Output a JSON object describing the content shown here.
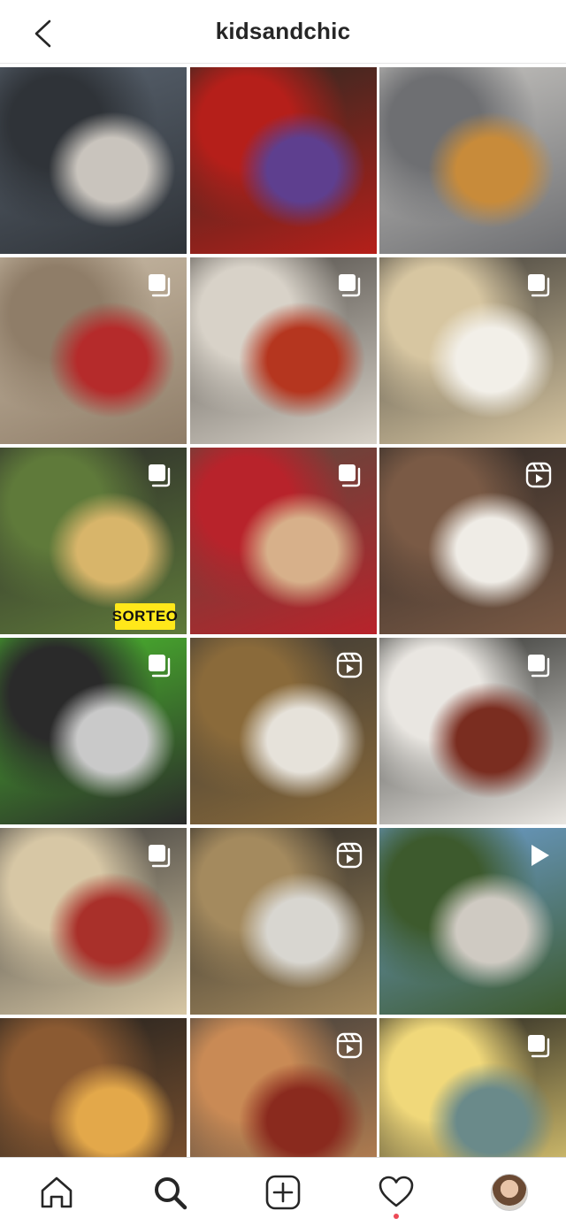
{
  "header": {
    "title": "kidsandchic",
    "back_icon": "chevron-left-icon"
  },
  "grid": {
    "tiles": [
      {
        "name": "beer-bottle-post",
        "badge": "none",
        "colors": [
          "#5a6470",
          "#2f3338",
          "#c9c4bd"
        ]
      },
      {
        "name": "strawberries-post",
        "badge": "none",
        "colors": [
          "#2a2a22",
          "#b51f1a",
          "#5e3f8f"
        ]
      },
      {
        "name": "french-toast-post",
        "badge": "none",
        "colors": [
          "#c8c6c2",
          "#6e6f72",
          "#c88b3a"
        ]
      },
      {
        "name": "woman-cathedral-post",
        "badge": "carousel",
        "colors": [
          "#c9bba6",
          "#8f7d68",
          "#b52b2b"
        ]
      },
      {
        "name": "soup-bowl-post",
        "badge": "carousel",
        "colors": [
          "#4e4a45",
          "#d8d2c8",
          "#b5361f"
        ]
      },
      {
        "name": "sugar-donuts-post",
        "badge": "carousel",
        "colors": [
          "#3f3c37",
          "#d7c6a1",
          "#f2efe8"
        ]
      },
      {
        "name": "gyoza-post",
        "badge": "carousel",
        "colors": [
          "#2b2b2a",
          "#5f7a3a",
          "#d8b56a"
        ]
      },
      {
        "name": "apple-pan-post",
        "badge": "carousel",
        "colors": [
          "#5b4a3e",
          "#b8232b",
          "#d7b08a"
        ]
      },
      {
        "name": "chocolate-dessert-post",
        "badge": "reel",
        "colors": [
          "#2c2725",
          "#7a5a45",
          "#efece6"
        ]
      },
      {
        "name": "sorteo-locker-post",
        "badge": "carousel",
        "colors": [
          "#4dbf2e",
          "#2a2a2a",
          "#c9c9c9"
        ]
      },
      {
        "name": "cream-soup-post",
        "badge": "reel",
        "colors": [
          "#3a3835",
          "#8a6a3a",
          "#e6e2da"
        ]
      },
      {
        "name": "glazed-donuts-post",
        "badge": "carousel",
        "colors": [
          "#2c2d2a",
          "#e9e6e1",
          "#7a2d20"
        ]
      },
      {
        "name": "bread-jam-post",
        "badge": "carousel",
        "colors": [
          "#3b3a38",
          "#d7c7a5",
          "#a9302a"
        ]
      },
      {
        "name": "cake-slice-post",
        "badge": "reel",
        "colors": [
          "#2a2826",
          "#a48a5e",
          "#d8d6d0"
        ]
      },
      {
        "name": "wine-landscape-post",
        "badge": "video",
        "colors": [
          "#6ea0d4",
          "#3d5a2d",
          "#cfcac2"
        ]
      },
      {
        "name": "steak-board-post",
        "badge": "none",
        "colors": [
          "#1f1f1e",
          "#8b5a32",
          "#e3a84a"
        ]
      },
      {
        "name": "galette-post",
        "badge": "reel",
        "colors": [
          "#3a3b3a",
          "#c98a55",
          "#8a2a1e"
        ]
      },
      {
        "name": "mashed-potato-post",
        "badge": "carousel",
        "colors": [
          "#1c1c1c",
          "#f0d87a",
          "#6a8a8a"
        ]
      },
      {
        "name": "partial-1",
        "badge": "none",
        "colors": [
          "#3b2a25",
          "#6e4a3a",
          "#2a2a2a"
        ]
      },
      {
        "name": "partial-2",
        "badge": "none",
        "colors": [
          "#2a2a2a",
          "#4a4a4a",
          "#3a3a3a"
        ]
      },
      {
        "name": "partial-3",
        "badge": "none",
        "colors": [
          "#d9d5cf",
          "#e8e3dc",
          "#cfc8be"
        ]
      }
    ],
    "sorteo_label": "SORTEO"
  },
  "navbar": {
    "items": [
      "home-icon",
      "search-icon",
      "new-post-icon",
      "activity-heart-icon",
      "profile-avatar"
    ],
    "notification_dot_color": "#ed4956"
  }
}
